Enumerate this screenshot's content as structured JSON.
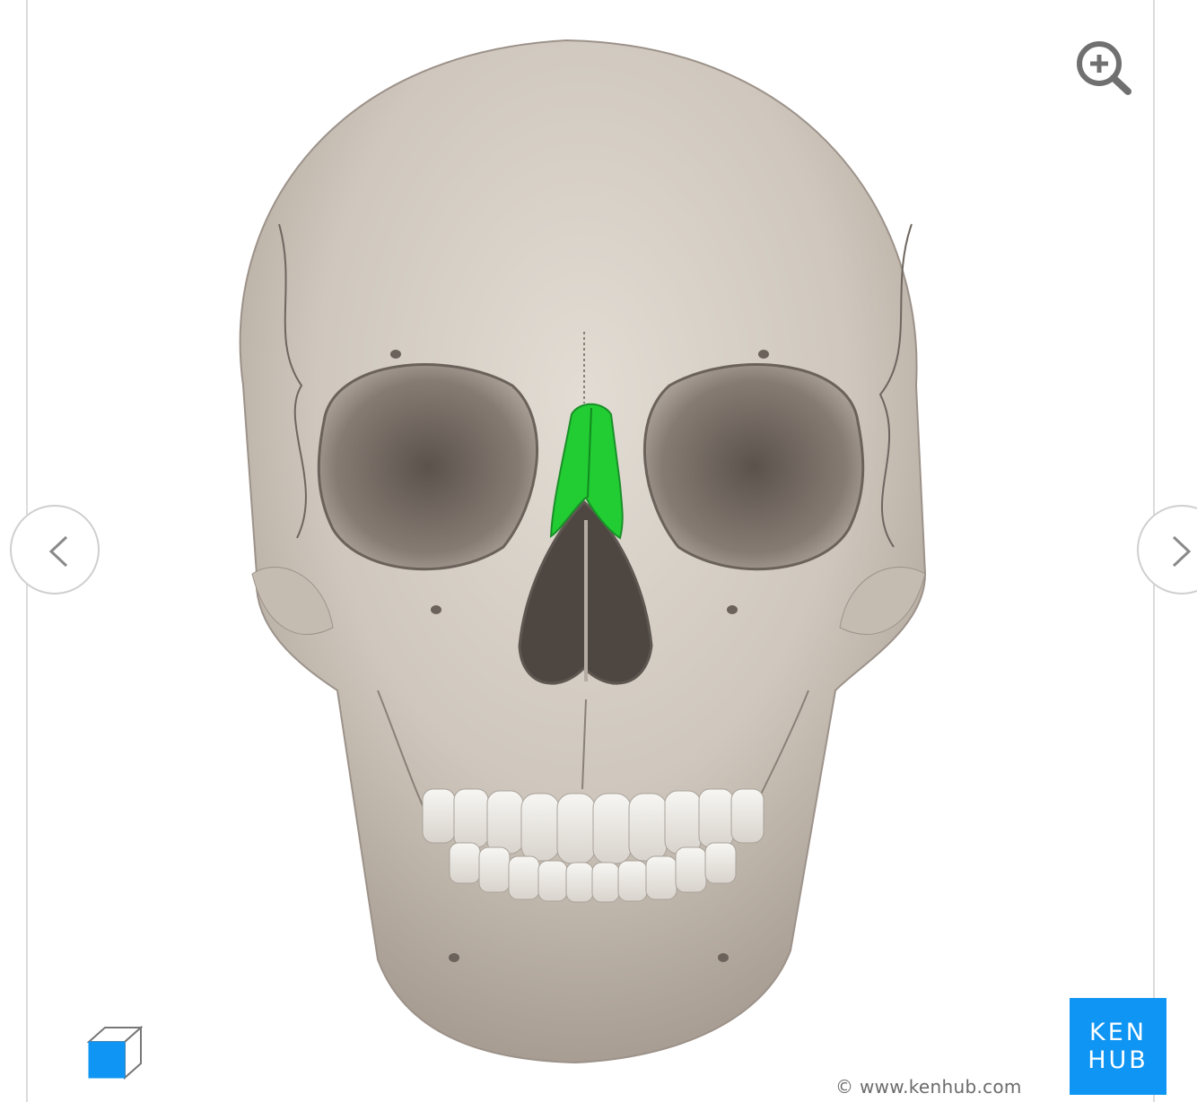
{
  "viewer": {
    "zoom_icon": "zoom-in-icon",
    "prev_icon": "chevron-left-icon",
    "next_icon": "chevron-right-icon",
    "model_icon": "3d-cube-icon",
    "highlight_color": "#22cc33"
  },
  "brand": {
    "logo_line1": "KEN",
    "logo_line2": "HUB",
    "logo_color": "#0f95f3",
    "copyright": "© www.kenhub.com"
  }
}
